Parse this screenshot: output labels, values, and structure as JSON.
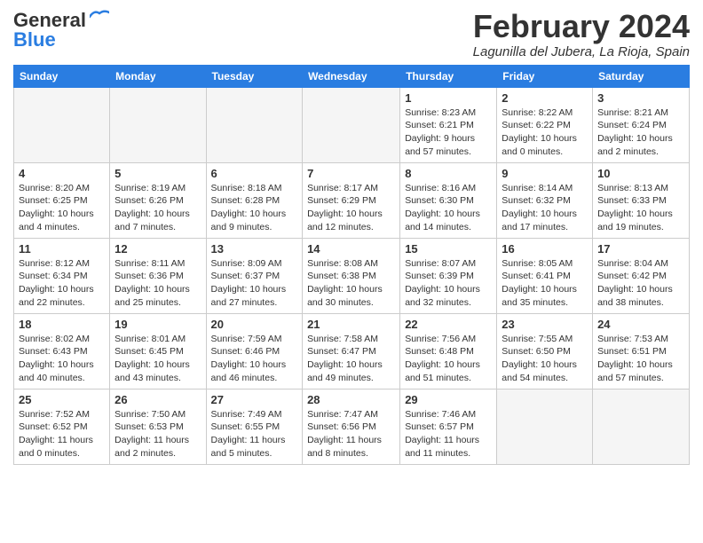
{
  "logo": {
    "general": "General",
    "blue": "Blue"
  },
  "header": {
    "month": "February 2024",
    "location": "Lagunilla del Jubera, La Rioja, Spain"
  },
  "weekdays": [
    "Sunday",
    "Monday",
    "Tuesday",
    "Wednesday",
    "Thursday",
    "Friday",
    "Saturday"
  ],
  "weeks": [
    [
      {
        "day": "",
        "empty": true
      },
      {
        "day": "",
        "empty": true
      },
      {
        "day": "",
        "empty": true
      },
      {
        "day": "",
        "empty": true
      },
      {
        "day": "1",
        "sunrise": "8:23 AM",
        "sunset": "6:21 PM",
        "daylight": "9 hours and 57 minutes."
      },
      {
        "day": "2",
        "sunrise": "8:22 AM",
        "sunset": "6:22 PM",
        "daylight": "10 hours and 0 minutes."
      },
      {
        "day": "3",
        "sunrise": "8:21 AM",
        "sunset": "6:24 PM",
        "daylight": "10 hours and 2 minutes."
      }
    ],
    [
      {
        "day": "4",
        "sunrise": "8:20 AM",
        "sunset": "6:25 PM",
        "daylight": "10 hours and 4 minutes."
      },
      {
        "day": "5",
        "sunrise": "8:19 AM",
        "sunset": "6:26 PM",
        "daylight": "10 hours and 7 minutes."
      },
      {
        "day": "6",
        "sunrise": "8:18 AM",
        "sunset": "6:28 PM",
        "daylight": "10 hours and 9 minutes."
      },
      {
        "day": "7",
        "sunrise": "8:17 AM",
        "sunset": "6:29 PM",
        "daylight": "10 hours and 12 minutes."
      },
      {
        "day": "8",
        "sunrise": "8:16 AM",
        "sunset": "6:30 PM",
        "daylight": "10 hours and 14 minutes."
      },
      {
        "day": "9",
        "sunrise": "8:14 AM",
        "sunset": "6:32 PM",
        "daylight": "10 hours and 17 minutes."
      },
      {
        "day": "10",
        "sunrise": "8:13 AM",
        "sunset": "6:33 PM",
        "daylight": "10 hours and 19 minutes."
      }
    ],
    [
      {
        "day": "11",
        "sunrise": "8:12 AM",
        "sunset": "6:34 PM",
        "daylight": "10 hours and 22 minutes."
      },
      {
        "day": "12",
        "sunrise": "8:11 AM",
        "sunset": "6:36 PM",
        "daylight": "10 hours and 25 minutes."
      },
      {
        "day": "13",
        "sunrise": "8:09 AM",
        "sunset": "6:37 PM",
        "daylight": "10 hours and 27 minutes."
      },
      {
        "day": "14",
        "sunrise": "8:08 AM",
        "sunset": "6:38 PM",
        "daylight": "10 hours and 30 minutes."
      },
      {
        "day": "15",
        "sunrise": "8:07 AM",
        "sunset": "6:39 PM",
        "daylight": "10 hours and 32 minutes."
      },
      {
        "day": "16",
        "sunrise": "8:05 AM",
        "sunset": "6:41 PM",
        "daylight": "10 hours and 35 minutes."
      },
      {
        "day": "17",
        "sunrise": "8:04 AM",
        "sunset": "6:42 PM",
        "daylight": "10 hours and 38 minutes."
      }
    ],
    [
      {
        "day": "18",
        "sunrise": "8:02 AM",
        "sunset": "6:43 PM",
        "daylight": "10 hours and 40 minutes."
      },
      {
        "day": "19",
        "sunrise": "8:01 AM",
        "sunset": "6:45 PM",
        "daylight": "10 hours and 43 minutes."
      },
      {
        "day": "20",
        "sunrise": "7:59 AM",
        "sunset": "6:46 PM",
        "daylight": "10 hours and 46 minutes."
      },
      {
        "day": "21",
        "sunrise": "7:58 AM",
        "sunset": "6:47 PM",
        "daylight": "10 hours and 49 minutes."
      },
      {
        "day": "22",
        "sunrise": "7:56 AM",
        "sunset": "6:48 PM",
        "daylight": "10 hours and 51 minutes."
      },
      {
        "day": "23",
        "sunrise": "7:55 AM",
        "sunset": "6:50 PM",
        "daylight": "10 hours and 54 minutes."
      },
      {
        "day": "24",
        "sunrise": "7:53 AM",
        "sunset": "6:51 PM",
        "daylight": "10 hours and 57 minutes."
      }
    ],
    [
      {
        "day": "25",
        "sunrise": "7:52 AM",
        "sunset": "6:52 PM",
        "daylight": "11 hours and 0 minutes."
      },
      {
        "day": "26",
        "sunrise": "7:50 AM",
        "sunset": "6:53 PM",
        "daylight": "11 hours and 2 minutes."
      },
      {
        "day": "27",
        "sunrise": "7:49 AM",
        "sunset": "6:55 PM",
        "daylight": "11 hours and 5 minutes."
      },
      {
        "day": "28",
        "sunrise": "7:47 AM",
        "sunset": "6:56 PM",
        "daylight": "11 hours and 8 minutes."
      },
      {
        "day": "29",
        "sunrise": "7:46 AM",
        "sunset": "6:57 PM",
        "daylight": "11 hours and 11 minutes."
      },
      {
        "day": "",
        "empty": true
      },
      {
        "day": "",
        "empty": true
      }
    ]
  ]
}
